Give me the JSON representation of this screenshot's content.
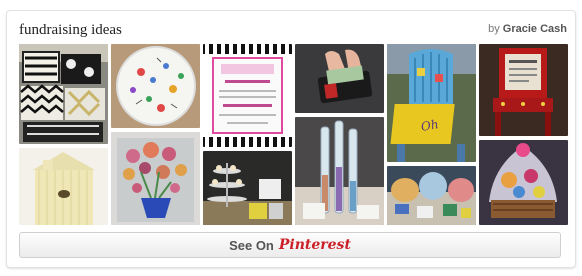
{
  "header": {
    "board_title": "fundraising ideas",
    "by_label": "by",
    "author": "Gracie Cash"
  },
  "button": {
    "see_on_label": "See On",
    "brand": "Pinterest"
  },
  "colors": {
    "brand_red": "#cb2027",
    "border": "#e2e2e2"
  },
  "pins": [
    {
      "name": "pin-pillows",
      "description": "patterned black and white pillows"
    },
    {
      "name": "pin-birdhouse",
      "description": "yellow wooden birdhouse"
    },
    {
      "name": "pin-painted-plate",
      "description": "hand-painted plate with drawings"
    },
    {
      "name": "pin-flower-painting",
      "description": "painting of flowers in a vase"
    },
    {
      "name": "pin-invitation",
      "description": "pink event invitation card"
    },
    {
      "name": "pin-cupcake-stand",
      "description": "tiered cupcake stand display"
    },
    {
      "name": "pin-wallet-cash",
      "description": "hands holding wallet with cash"
    },
    {
      "name": "pin-raffle-tubes",
      "description": "raffle tubes on table"
    },
    {
      "name": "pin-painted-chair",
      "description": "painted adirondack chair"
    },
    {
      "name": "pin-gift-baskets",
      "description": "gift baskets table"
    },
    {
      "name": "pin-decorated-chair",
      "description": "decorated red chair"
    },
    {
      "name": "pin-gift-basket",
      "description": "wrapped gift basket"
    }
  ]
}
